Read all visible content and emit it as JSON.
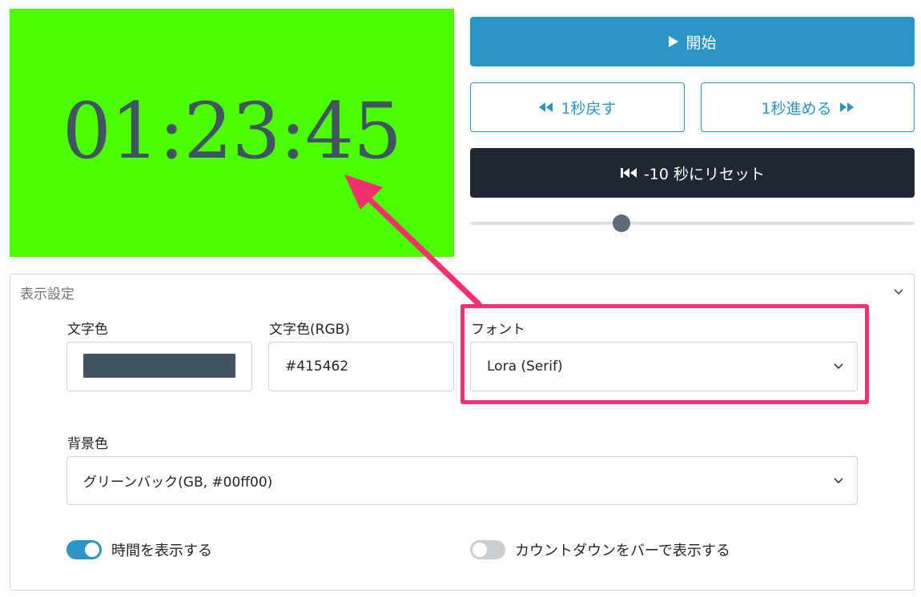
{
  "preview": {
    "time": "01:23:45",
    "background": "#4cff00",
    "text_color": "#415462"
  },
  "controls": {
    "start_label": "開始",
    "back_label": "1秒戻す",
    "forward_label": "1秒進める",
    "reset_label": "-10 秒にリセット",
    "slider_value": 0.34,
    "colors": {
      "primary": "#2b95c6",
      "dark": "#1d2833"
    }
  },
  "settings": {
    "title": "表示設定",
    "text_color_label": "文字色",
    "text_color_value": "#415462",
    "text_color_rgb_label": "文字色(RGB)",
    "text_color_rgb_value": "#415462",
    "font_label": "フォント",
    "font_value": "Lora (Serif)",
    "bg_label": "背景色",
    "bg_value": "グリーンバック(GB, #00ff00)",
    "show_time_label": "時間を表示する",
    "show_time_on": true,
    "show_bar_label": "カウントダウンをバーで表示する",
    "show_bar_on": false
  },
  "annotation": {
    "highlight_color": "#f4306f"
  }
}
